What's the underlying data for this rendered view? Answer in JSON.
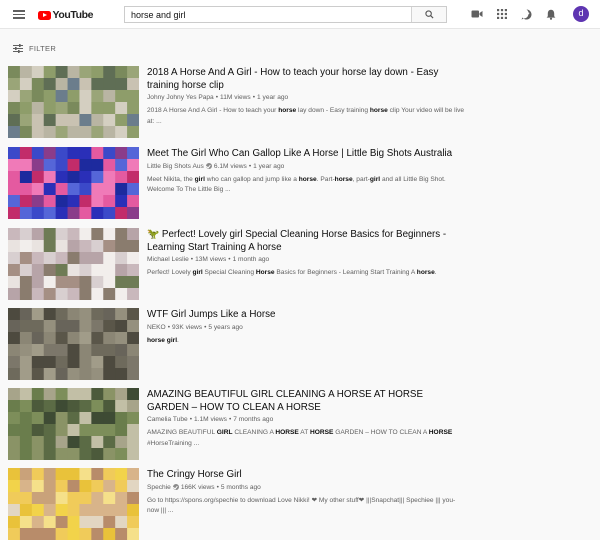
{
  "header": {
    "logo_text": "YouTube",
    "search_value": "horse and girl",
    "avatar_letter": "d"
  },
  "filter": {
    "label": "FILTER"
  },
  "results": [
    {
      "title": "2018 A Horse And A Girl - How to teach your horse lay down - Easy training horse clip",
      "channel": "Johny Johny Yes Papa",
      "verified": false,
      "views": "11M views",
      "age": "1 year ago",
      "description": "2018 A Horse And A Girl - How to teach your **horse** lay down - Easy training **horse** clip Your video will be live at: ..."
    },
    {
      "title": "Meet The Girl Who Can Gallop Like A Horse | Little Big Shots Australia",
      "channel": "Little Big Shots Aus",
      "verified": true,
      "views": "6.1M views",
      "age": "1 year ago",
      "description": "Meet Nikita, the **girl** who can gallop and jump like a **horse**. Part-**horse**, part-**girl** and all Little Big Shot. Welcome To The Little Big ..."
    },
    {
      "title": "🦖 Perfect! Lovely girl Special Cleaning Horse Basics for Beginners - Learning Start Training A horse",
      "channel": "Michael Leslie",
      "verified": false,
      "views": "13M views",
      "age": "1 month ago",
      "description": "Perfect! Lovely **girl** Special Cleaning **Horse** Basics for Beginners - Learning Start Training A **horse**."
    },
    {
      "title": "WTF Girl Jumps Like a Horse",
      "channel": "NEKO",
      "verified": false,
      "views": "93K views",
      "age": "5 years ago",
      "description": "**horse girl**."
    },
    {
      "title": "AMAZING BEAUTIFUL GIRL CLEANING A HORSE AT HORSE GARDEN – HOW TO CLEAN A HORSE",
      "channel": "Camelia Tube",
      "verified": false,
      "views": "1.1M views",
      "age": "7 months ago",
      "description": "AMAZING BEAUTIFUL **GIRL** CLEANING A **HORSE** AT **HORSE** GARDEN – HOW TO CLEAN A **HORSE** #HorseTraining ..."
    },
    {
      "title": "The Cringy Horse Girl",
      "channel": "Spechie",
      "verified": true,
      "views": "166K views",
      "age": "5 months ago",
      "description": "Go to https://spons.org/spechie to download Love Nikki! ❤ My other stuff❤ |||Snapchat||| Spechiee ||| you-now ||| ..."
    }
  ],
  "thumb_palettes": [
    [
      "#7a8a5c",
      "#9aa578",
      "#c9c2b2",
      "#6b7d8c",
      "#b9b5a3",
      "#8e9d6a",
      "#d4cfc1",
      "#5f6e55"
    ],
    [
      "#2a2fb8",
      "#5566d8",
      "#c22c6a",
      "#e45aa0",
      "#1d2a9e",
      "#8a3c8a",
      "#f07ab8",
      "#3b49c9"
    ],
    [
      "#d8cfd0",
      "#b7a4a8",
      "#8a7c6e",
      "#e9e3e0",
      "#6e7b55",
      "#c9b8bc",
      "#a58f84",
      "#f2eeec"
    ],
    [
      "#6e6a5c",
      "#8b8675",
      "#5a5649",
      "#a19c89",
      "#4d4a3f",
      "#7c776a",
      "#95907e",
      "#68645a"
    ],
    [
      "#5b6b45",
      "#7d8e5a",
      "#3e4b34",
      "#a7a48a",
      "#6a7d4c",
      "#c2bfa6",
      "#4c5a3b",
      "#8a9366"
    ],
    [
      "#f2d34a",
      "#e9c23a",
      "#d8b48a",
      "#c9a27a",
      "#f5e08a",
      "#b88c6a",
      "#f0cb5a",
      "#e2d6c2"
    ]
  ]
}
